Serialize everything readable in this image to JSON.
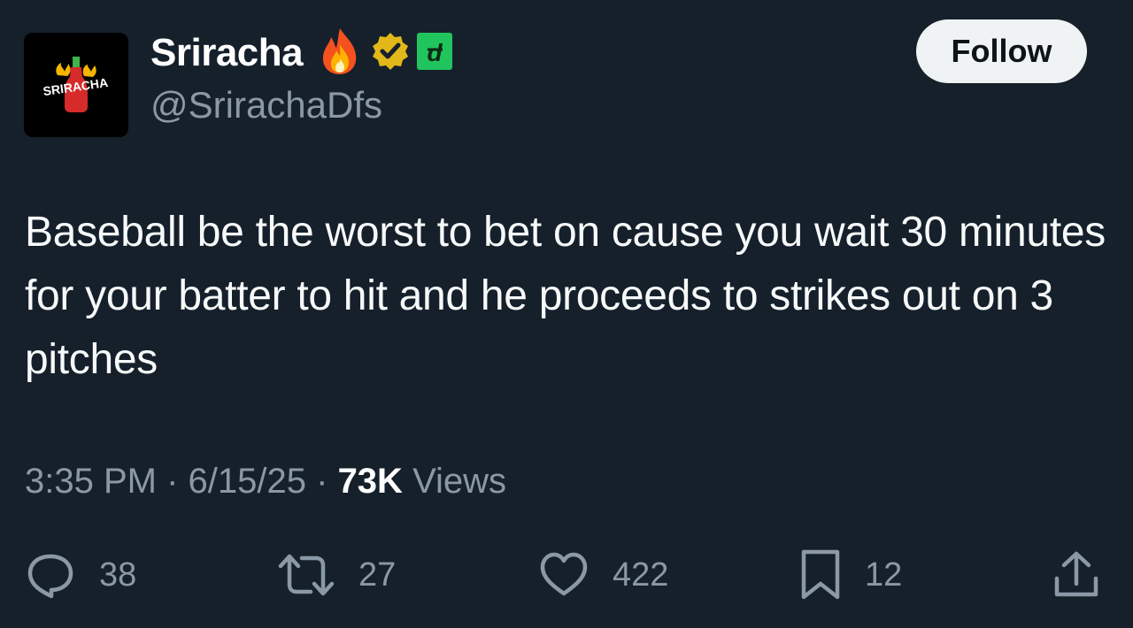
{
  "user": {
    "display_name": "Sriracha",
    "handle": "@SrirachaDfs",
    "avatar_text": "SRIRACHA",
    "badges": [
      "fire-emoji",
      "verified-gold-badge",
      "affiliate-badge"
    ]
  },
  "follow_button": {
    "label": "Follow"
  },
  "tweet": {
    "text": "Baseball be the worst to bet on cause you wait 30 minutes for your batter to hit and he proceeds to strikes out on 3 pitches"
  },
  "meta": {
    "time": "3:35 PM",
    "separator": "·",
    "date": "6/15/25",
    "views_count": "73K",
    "views_label": "Views"
  },
  "actions": {
    "replies": "38",
    "retweets": "27",
    "likes": "422",
    "bookmarks": "12"
  },
  "colors": {
    "background": "#15202b",
    "muted_text": "#8b98a5",
    "verified_gold": "#e2b719",
    "affiliate_green": "#21c55d"
  }
}
